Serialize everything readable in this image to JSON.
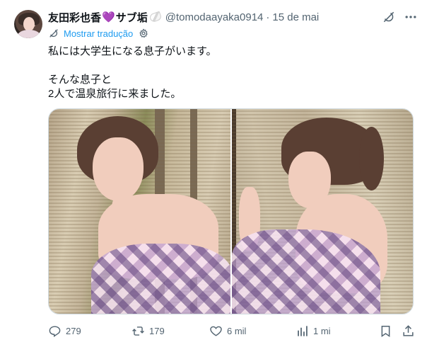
{
  "author": {
    "display_name": "友田彩也香",
    "heart": "💜",
    "display_name_suffix": "サブ垢",
    "handle": "@tomodaayaka0914",
    "separator": "·",
    "date": "15 de mai"
  },
  "translate": {
    "label": "Mostrar tradução"
  },
  "text": {
    "line1": "私には大学生になる息子がいます。",
    "line2": "そんな息子と",
    "line3": "2人で温泉旅行に来ました。"
  },
  "media": {
    "photo_count": 2
  },
  "actions": {
    "replies": "279",
    "reposts": "179",
    "likes": "6 mil",
    "views": "1 mi"
  },
  "colors": {
    "link": "#1d9bf0",
    "muted": "#536471",
    "text": "#0f1419"
  },
  "icons": [
    "grok-icon",
    "more-icon",
    "translate-icon",
    "settings-icon",
    "reply-icon",
    "repost-icon",
    "like-icon",
    "views-icon",
    "bookmark-icon",
    "share-icon"
  ]
}
